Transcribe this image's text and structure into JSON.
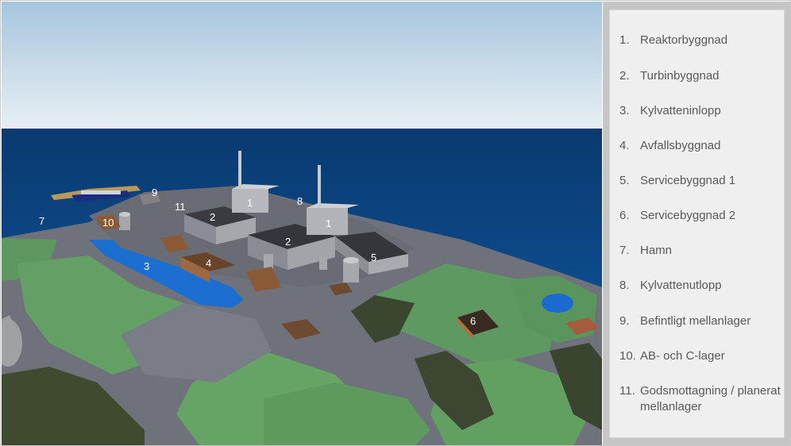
{
  "scene": {
    "markers": [
      {
        "id": "m-1a",
        "text": "1"
      },
      {
        "id": "m-1b",
        "text": "1"
      },
      {
        "id": "m-2a",
        "text": "2"
      },
      {
        "id": "m-2b",
        "text": "2"
      },
      {
        "id": "m-3",
        "text": "3"
      },
      {
        "id": "m-4",
        "text": "4"
      },
      {
        "id": "m-5",
        "text": "5"
      },
      {
        "id": "m-6",
        "text": "6"
      },
      {
        "id": "m-7",
        "text": "7"
      },
      {
        "id": "m-8",
        "text": "8"
      },
      {
        "id": "m-9",
        "text": "9"
      },
      {
        "id": "m-10",
        "text": "10"
      },
      {
        "id": "m-11",
        "text": "11"
      }
    ],
    "colors": {
      "sky_top": "#a9c8de",
      "sky_bottom": "#e4edf3",
      "sea": "#0b3f78",
      "land_green": "#5f9a62",
      "road_grey": "#6d7079",
      "building_grey": "#8f9097",
      "roof_dark": "#3a3b40",
      "building_brown": "#8a5a36"
    }
  },
  "legend": {
    "items": [
      {
        "num": "1.",
        "text": "Reaktorbyggnad"
      },
      {
        "num": "2.",
        "text": "Turbinbyggnad"
      },
      {
        "num": "3.",
        "text": "Kylvatteninlopp"
      },
      {
        "num": "4.",
        "text": "Avfallsbyggnad"
      },
      {
        "num": "5.",
        "text": "Servicebyggnad 1"
      },
      {
        "num": "6.",
        "text": "Servicebyggnad 2"
      },
      {
        "num": "7.",
        "text": "Hamn"
      },
      {
        "num": "8.",
        "text": "Kylvattenutlopp"
      },
      {
        "num": "9.",
        "text": "Befintligt mellanlager"
      },
      {
        "num": "10.",
        "text": "AB- och C-lager"
      },
      {
        "num": "11.",
        "text": "Godsmottagning / planerat mellanlager"
      }
    ]
  }
}
